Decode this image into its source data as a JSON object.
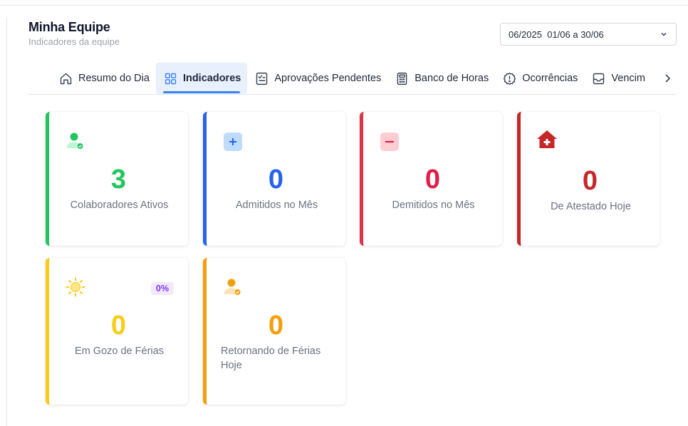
{
  "header": {
    "title": "Minha Equipe",
    "subtitle": "Indicadores da equipe"
  },
  "period": {
    "value": "06/2025  01/06 a 30/06"
  },
  "tabs": [
    {
      "label": "Resumo do Dia",
      "icon": "home-icon",
      "active": false
    },
    {
      "label": "Indicadores",
      "icon": "grid-icon",
      "active": true
    },
    {
      "label": "Aprovações Pendentes",
      "icon": "checklist-icon",
      "active": false
    },
    {
      "label": "Banco de Horas",
      "icon": "calculator-icon",
      "active": false
    },
    {
      "label": "Ocorrências",
      "icon": "alert-circle-icon",
      "active": false
    },
    {
      "label": "Vencim",
      "icon": "inbox-icon",
      "active": false
    }
  ],
  "cards": [
    {
      "value": "3",
      "label": "Colaboradores Ativos",
      "color": "#22c55e",
      "icon": "user-check-icon"
    },
    {
      "value": "0",
      "label": "Admitidos no Mês",
      "color": "#2563eb",
      "icon": "plus-icon"
    },
    {
      "value": "0",
      "label": "Demitidos no Mês",
      "color": "#e11d48",
      "icon": "minus-icon"
    },
    {
      "value": "0",
      "label": "De Atestado Hoje",
      "color": "#c62828",
      "icon": "hospital-icon"
    },
    {
      "value": "0",
      "label": "Em Gozo de Férias",
      "color": "#facc15",
      "icon": "sun-icon",
      "badge": "0%"
    },
    {
      "value": "0",
      "label": "Retornando de Férias Hoje",
      "color": "#f59e0b",
      "icon": "user-return-icon"
    }
  ]
}
